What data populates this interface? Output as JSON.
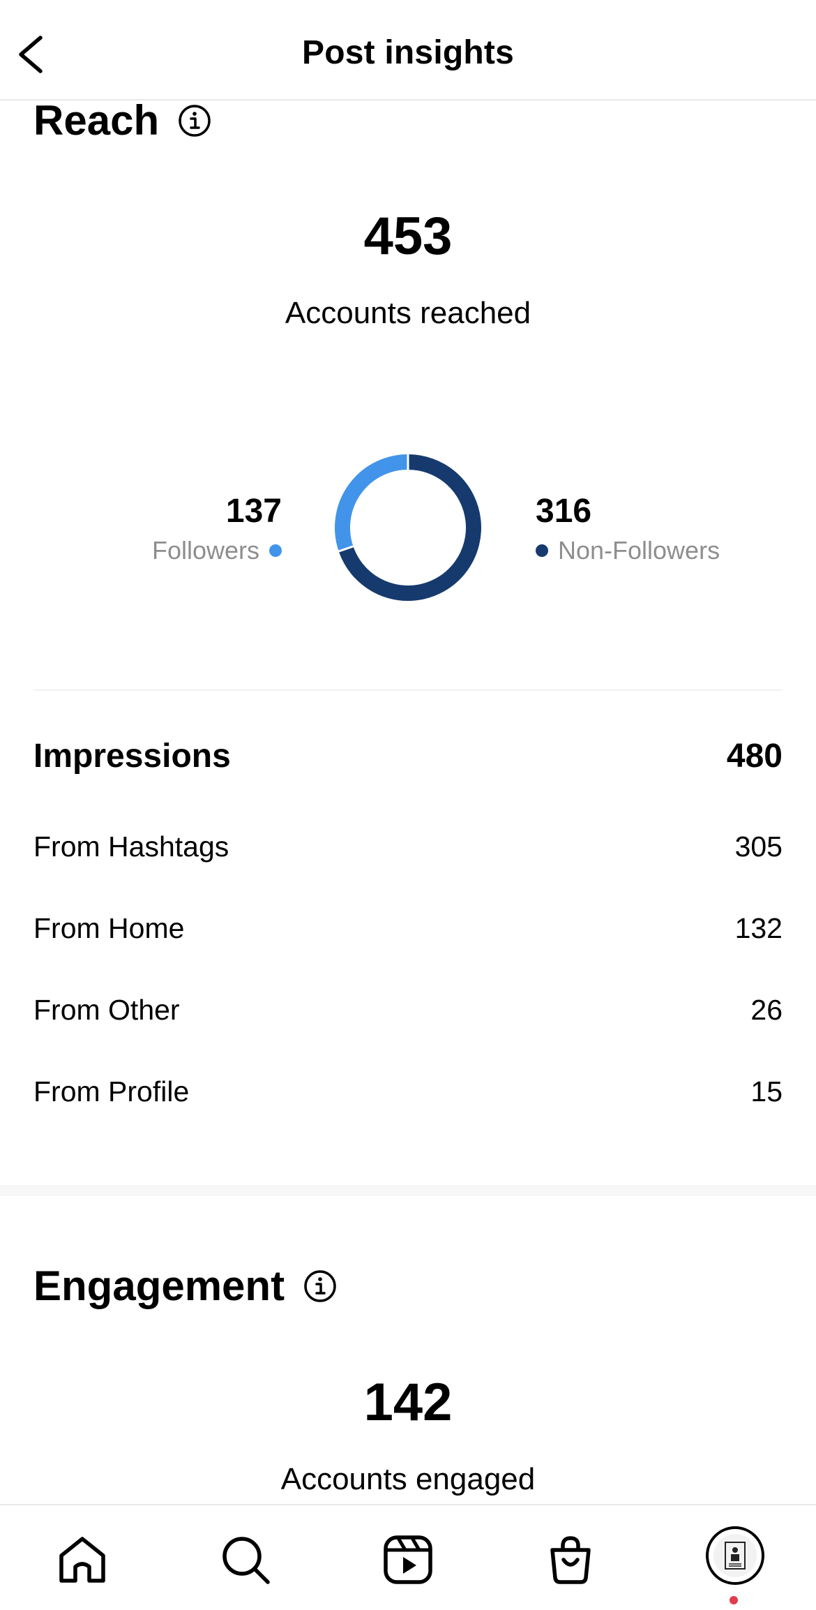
{
  "header": {
    "title": "Post insights"
  },
  "reach": {
    "title": "Reach",
    "accounts_reached": "453",
    "accounts_reached_label": "Accounts reached",
    "followers": {
      "value": "137",
      "label": "Followers",
      "color": "#4294EA"
    },
    "non_followers": {
      "value": "316",
      "label": "Non-Followers",
      "color": "#163A6E"
    }
  },
  "chart_data": {
    "type": "pie",
    "categories": [
      "Followers",
      "Non-Followers"
    ],
    "values": [
      137,
      316
    ],
    "colors": [
      "#4294EA",
      "#163A6E"
    ]
  },
  "impressions": {
    "label": "Impressions",
    "value": "480",
    "sources": [
      {
        "label": "From Hashtags",
        "value": "305"
      },
      {
        "label": "From Home",
        "value": "132"
      },
      {
        "label": "From Other",
        "value": "26"
      },
      {
        "label": "From Profile",
        "value": "15"
      }
    ]
  },
  "engagement": {
    "title": "Engagement",
    "accounts_engaged": "142",
    "accounts_engaged_label": "Accounts engaged"
  },
  "tabbar": {
    "items": [
      "home-icon",
      "search-icon",
      "reels-icon",
      "shop-icon",
      "profile-avatar"
    ],
    "notification_color": "#E23B4C"
  }
}
